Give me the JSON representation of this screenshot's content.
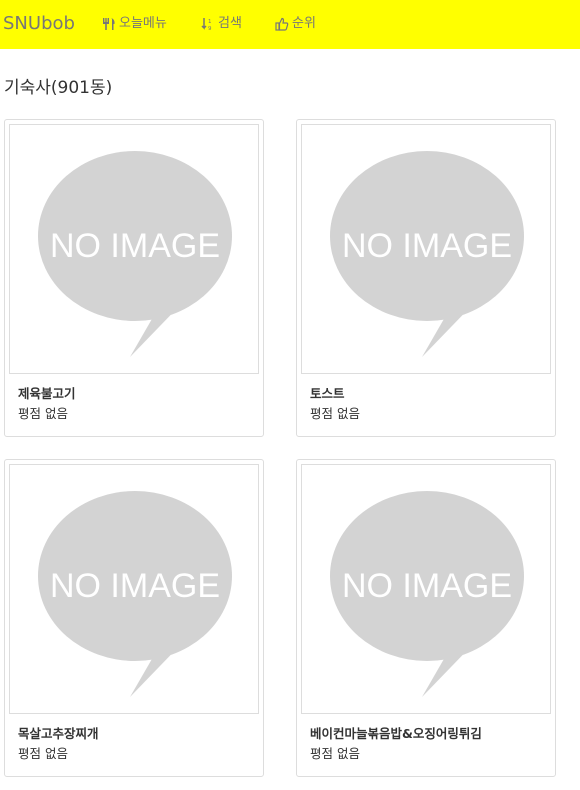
{
  "navbar": {
    "brand": "SNUbob",
    "background_color": "#ffff00",
    "links": [
      {
        "label": "오늘메뉴",
        "icon": "cutlery-icon"
      },
      {
        "label": "검색",
        "icon": "sort-icon"
      },
      {
        "label": "순위",
        "icon": "thumbs-up-icon"
      }
    ]
  },
  "section": {
    "title": "기숙사(901동)"
  },
  "placeholder_text": "NO IMAGE",
  "cards": [
    {
      "name": "제육불고기",
      "rating": "평점 없음"
    },
    {
      "name": "토스트",
      "rating": "평점 없음"
    },
    {
      "name": "목살고추장찌개",
      "rating": "평점 없음"
    },
    {
      "name": "베이컨마늘볶음밥&오징어링튀김",
      "rating": "평점 없음"
    }
  ]
}
